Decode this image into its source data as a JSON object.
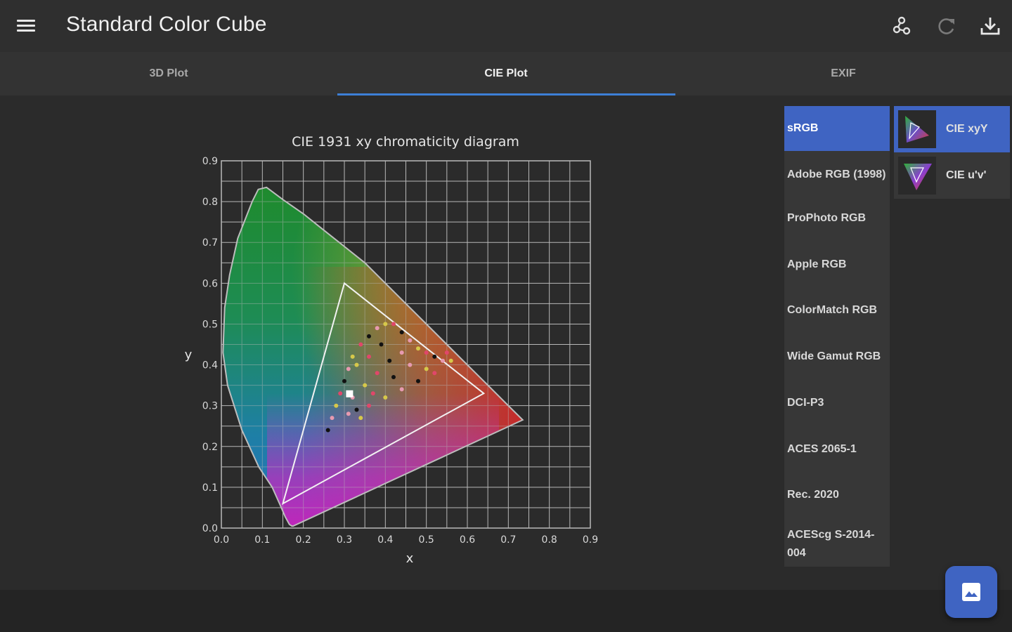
{
  "app": {
    "title": "Standard Color Cube"
  },
  "toolbar": {
    "icons": [
      "menu-icon",
      "connection-icon",
      "refresh-icon",
      "download-icon"
    ]
  },
  "tabs": [
    {
      "label": "3D Plot",
      "active": false
    },
    {
      "label": "CIE Plot",
      "active": true
    },
    {
      "label": "EXIF",
      "active": false
    }
  ],
  "color_spaces": [
    {
      "label": "sRGB",
      "selected": true
    },
    {
      "label": "Adobe RGB (1998)",
      "selected": false
    },
    {
      "label": "ProPhoto RGB",
      "selected": false
    },
    {
      "label": "Apple RGB",
      "selected": false
    },
    {
      "label": "ColorMatch RGB",
      "selected": false
    },
    {
      "label": "Wide Gamut RGB",
      "selected": false
    },
    {
      "label": "DCI-P3",
      "selected": false
    },
    {
      "label": "ACES 2065-1",
      "selected": false
    },
    {
      "label": "Rec. 2020",
      "selected": false
    },
    {
      "label": "ACEScg S-2014-004",
      "selected": false
    }
  ],
  "plot_modes": [
    {
      "label": "CIE xyY",
      "selected": true
    },
    {
      "label": "CIE u'v'",
      "selected": false
    }
  ],
  "colors": {
    "accent": "#3f64c2",
    "tab_indicator": "#3d7fd6"
  },
  "chart_data": {
    "type": "scatter",
    "title": "CIE 1931 xy chromaticity diagram",
    "xlabel": "x",
    "ylabel": "y",
    "xlim": [
      0.0,
      0.9
    ],
    "ylim": [
      0.0,
      0.9
    ],
    "grid": true,
    "x_ticks": [
      "0.0",
      "0.1",
      "0.2",
      "0.3",
      "0.4",
      "0.5",
      "0.6",
      "0.7",
      "0.8",
      "0.9"
    ],
    "y_ticks": [
      "0.0",
      "0.1",
      "0.2",
      "0.3",
      "0.4",
      "0.5",
      "0.6",
      "0.7",
      "0.8",
      "0.9"
    ],
    "locus": [
      [
        0.175,
        0.005
      ],
      [
        0.172,
        0.005
      ],
      [
        0.166,
        0.009
      ],
      [
        0.156,
        0.027
      ],
      [
        0.144,
        0.055
      ],
      [
        0.124,
        0.1
      ],
      [
        0.091,
        0.15
      ],
      [
        0.05,
        0.24
      ],
      [
        0.015,
        0.35
      ],
      [
        0.004,
        0.43
      ],
      [
        0.008,
        0.54
      ],
      [
        0.02,
        0.62
      ],
      [
        0.04,
        0.71
      ],
      [
        0.075,
        0.8
      ],
      [
        0.09,
        0.83
      ],
      [
        0.11,
        0.835
      ],
      [
        0.15,
        0.805
      ],
      [
        0.2,
        0.77
      ],
      [
        0.25,
        0.73
      ],
      [
        0.3,
        0.69
      ],
      [
        0.35,
        0.65
      ],
      [
        0.4,
        0.6
      ],
      [
        0.45,
        0.55
      ],
      [
        0.5,
        0.5
      ],
      [
        0.55,
        0.45
      ],
      [
        0.6,
        0.4
      ],
      [
        0.65,
        0.35
      ],
      [
        0.7,
        0.3
      ],
      [
        0.735,
        0.265
      ],
      [
        0.175,
        0.005
      ]
    ],
    "gamut_triangle": [
      [
        0.64,
        0.33
      ],
      [
        0.3,
        0.6
      ],
      [
        0.15,
        0.06
      ]
    ],
    "white_point": [
      0.3127,
      0.329
    ],
    "image_points": [
      [
        0.26,
        0.24
      ],
      [
        0.27,
        0.27
      ],
      [
        0.28,
        0.3
      ],
      [
        0.29,
        0.33
      ],
      [
        0.3,
        0.36
      ],
      [
        0.31,
        0.39
      ],
      [
        0.32,
        0.42
      ],
      [
        0.34,
        0.45
      ],
      [
        0.36,
        0.47
      ],
      [
        0.38,
        0.49
      ],
      [
        0.4,
        0.5
      ],
      [
        0.42,
        0.5
      ],
      [
        0.44,
        0.48
      ],
      [
        0.46,
        0.46
      ],
      [
        0.48,
        0.44
      ],
      [
        0.5,
        0.43
      ],
      [
        0.52,
        0.42
      ],
      [
        0.54,
        0.41
      ],
      [
        0.56,
        0.41
      ],
      [
        0.52,
        0.38
      ],
      [
        0.48,
        0.36
      ],
      [
        0.44,
        0.34
      ],
      [
        0.4,
        0.32
      ],
      [
        0.36,
        0.3
      ],
      [
        0.33,
        0.29
      ],
      [
        0.32,
        0.32
      ],
      [
        0.35,
        0.35
      ],
      [
        0.38,
        0.38
      ],
      [
        0.41,
        0.41
      ],
      [
        0.44,
        0.43
      ],
      [
        0.33,
        0.4
      ],
      [
        0.36,
        0.42
      ],
      [
        0.39,
        0.45
      ],
      [
        0.31,
        0.28
      ],
      [
        0.34,
        0.27
      ],
      [
        0.37,
        0.33
      ],
      [
        0.42,
        0.37
      ],
      [
        0.46,
        0.4
      ],
      [
        0.5,
        0.39
      ],
      [
        0.55,
        0.43
      ]
    ]
  }
}
